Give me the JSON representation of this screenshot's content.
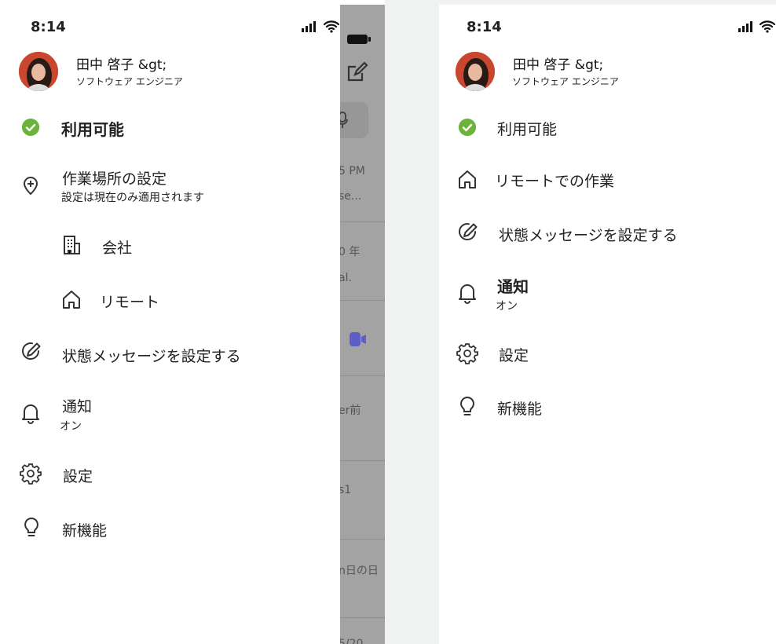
{
  "colors": {
    "available": "#6bb33a",
    "call_icon": "#5b5fc7",
    "dim_overlay": "#a3a3a3"
  },
  "left": {
    "status_bar": {
      "time": "8:14"
    },
    "profile": {
      "name": "田中 啓子 &gt;",
      "role": "ソフトウェア エンジニア"
    },
    "menu": {
      "availability": "利用可能",
      "work_location": "作業場所の設定",
      "work_location_sub": "設定は現在のみ適用されます",
      "office": "会社",
      "remote": "リモート",
      "status_message": "状態メッセージを設定する",
      "notifications": "通知",
      "notifications_sub": "オン",
      "settings": "設定",
      "whats_new": "新機能"
    },
    "behind_list": {
      "items": [
        "5 PM",
        "se...",
        "0 年",
        "al.",
        "er前",
        "s1",
        "n日の日",
        "5/20"
      ]
    }
  },
  "right": {
    "status_bar": {
      "time": "8:14"
    },
    "profile": {
      "name": "田中 啓子 &gt;",
      "role": "ソフトウェア エンジニア"
    },
    "menu": {
      "availability": "利用可能",
      "remote_work": "リモートでの作業",
      "status_message": "状態メッセージを設定する",
      "notifications": "通知",
      "notifications_sub": "オン",
      "settings": "設定",
      "whats_new": "新機能"
    }
  }
}
